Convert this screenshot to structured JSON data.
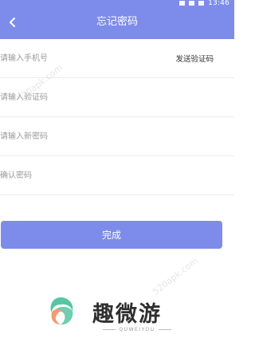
{
  "status_bar": {
    "time": "13:46"
  },
  "header": {
    "title": "忘记密码"
  },
  "form": {
    "phone_placeholder": "请输入手机号",
    "send_code_label": "发送验证码",
    "code_placeholder": "请输入验证码",
    "new_password_placeholder": "请输入新密码",
    "confirm_password_placeholder": "确认密码"
  },
  "submit_label": "完成",
  "watermark": {
    "text": "520apk.com"
  },
  "brand": {
    "name": "趣微游",
    "sub": "QUWEIYOU"
  },
  "colors": {
    "accent": "#7d8ceb",
    "logo_green": "#56c6a2",
    "logo_orange": "#f39a73"
  },
  "icons": {
    "back": "chevron-left-icon",
    "logo": "quweiyou-logo-icon"
  }
}
